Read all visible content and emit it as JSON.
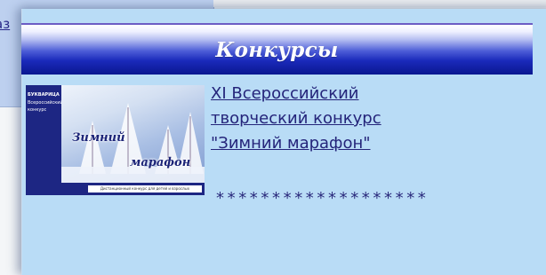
{
  "background": {
    "link_fragment": "аз"
  },
  "widget": {
    "title": "Конкурсы",
    "contest_link": {
      "line1": "XI Всероссийский",
      "line2": "творческий конкурс",
      "line3": "\"Зимний марафон\""
    },
    "thumbnail": {
      "alt": "Зимний марафон",
      "title_word1": "Зимний",
      "title_word2": "марафон",
      "left_lines": [
        "БУКВАРИЦА",
        "Всероссийский",
        "конкурс"
      ],
      "bottom_caption": "Дистанционный конкурс для детей и взрослых"
    },
    "separator": "*******************"
  },
  "colors": {
    "panel_bg": "#b9dcf6",
    "title_bar_dark": "#0a1790",
    "link": "#24247a"
  }
}
